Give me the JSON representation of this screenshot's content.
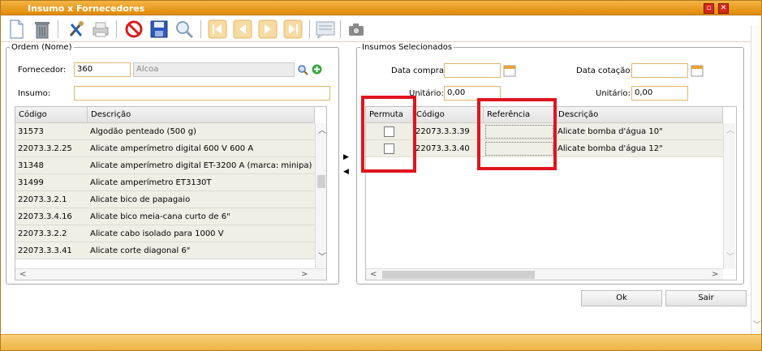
{
  "window": {
    "title": "Insumo x Fornecedores"
  },
  "ordem": {
    "legend": "Ordem (Nome)",
    "fornecedor_label": "Fornecedor:",
    "fornecedor_code": "360",
    "fornecedor_name": "Alcoa",
    "insumo_label": "Insumo:",
    "insumo_value": "",
    "columns": [
      "Código",
      "Descrição"
    ],
    "rows": [
      [
        "31573",
        "Algodão penteado (500 g)"
      ],
      [
        "22073.3.2.25",
        "Alicate amperímetro digital 600 V 600 A"
      ],
      [
        "31348",
        "Alicate amperímetro digital ET-3200 A (marca: minipa)"
      ],
      [
        "31499",
        "Alicate amperímetro ET3130T"
      ],
      [
        "22073.3.2.1",
        "Alicate bico de papagaio"
      ],
      [
        "22073.3.4.16",
        "Alicate bico meia-cana curto de 6\""
      ],
      [
        "22073.3.2.2",
        "Alicate cabo isolado para 1000 V"
      ],
      [
        "22073.3.3.41",
        "Alicate corte diagonal 6\""
      ]
    ]
  },
  "selecionados": {
    "legend": "Insumos Selecionados",
    "data_compra_label": "Data compra:",
    "data_compra_value": "",
    "data_cotacao_label": "Data cotação:",
    "data_cotacao_value": "",
    "unitario_label": "Unitário:",
    "unitario_left_value": "0,00",
    "unitario_right_value": "0,00",
    "columns": [
      "Permuta",
      "Código",
      "Referência",
      "Descrição"
    ],
    "rows": [
      {
        "permuta": false,
        "codigo": "22073.3.3.39",
        "referencia": "",
        "descricao": "Alicate bomba d'água 10\""
      },
      {
        "permuta": false,
        "codigo": "22073.3.3.40",
        "referencia": "",
        "descricao": "Alicate bomba d'água 12\""
      }
    ]
  },
  "buttons": {
    "ok": "Ok",
    "sair": "Sair"
  },
  "icons": {
    "toolbar": [
      "new-document-icon",
      "trash-icon",
      "tools-icon",
      "printer-icon",
      "cancel-icon",
      "save-icon",
      "search-icon",
      "first-icon",
      "previous-icon",
      "next-icon",
      "last-icon",
      "notes-icon",
      "camera-icon"
    ]
  },
  "colors": {
    "accent": "#e99a17",
    "highlight": "#e0141e"
  }
}
